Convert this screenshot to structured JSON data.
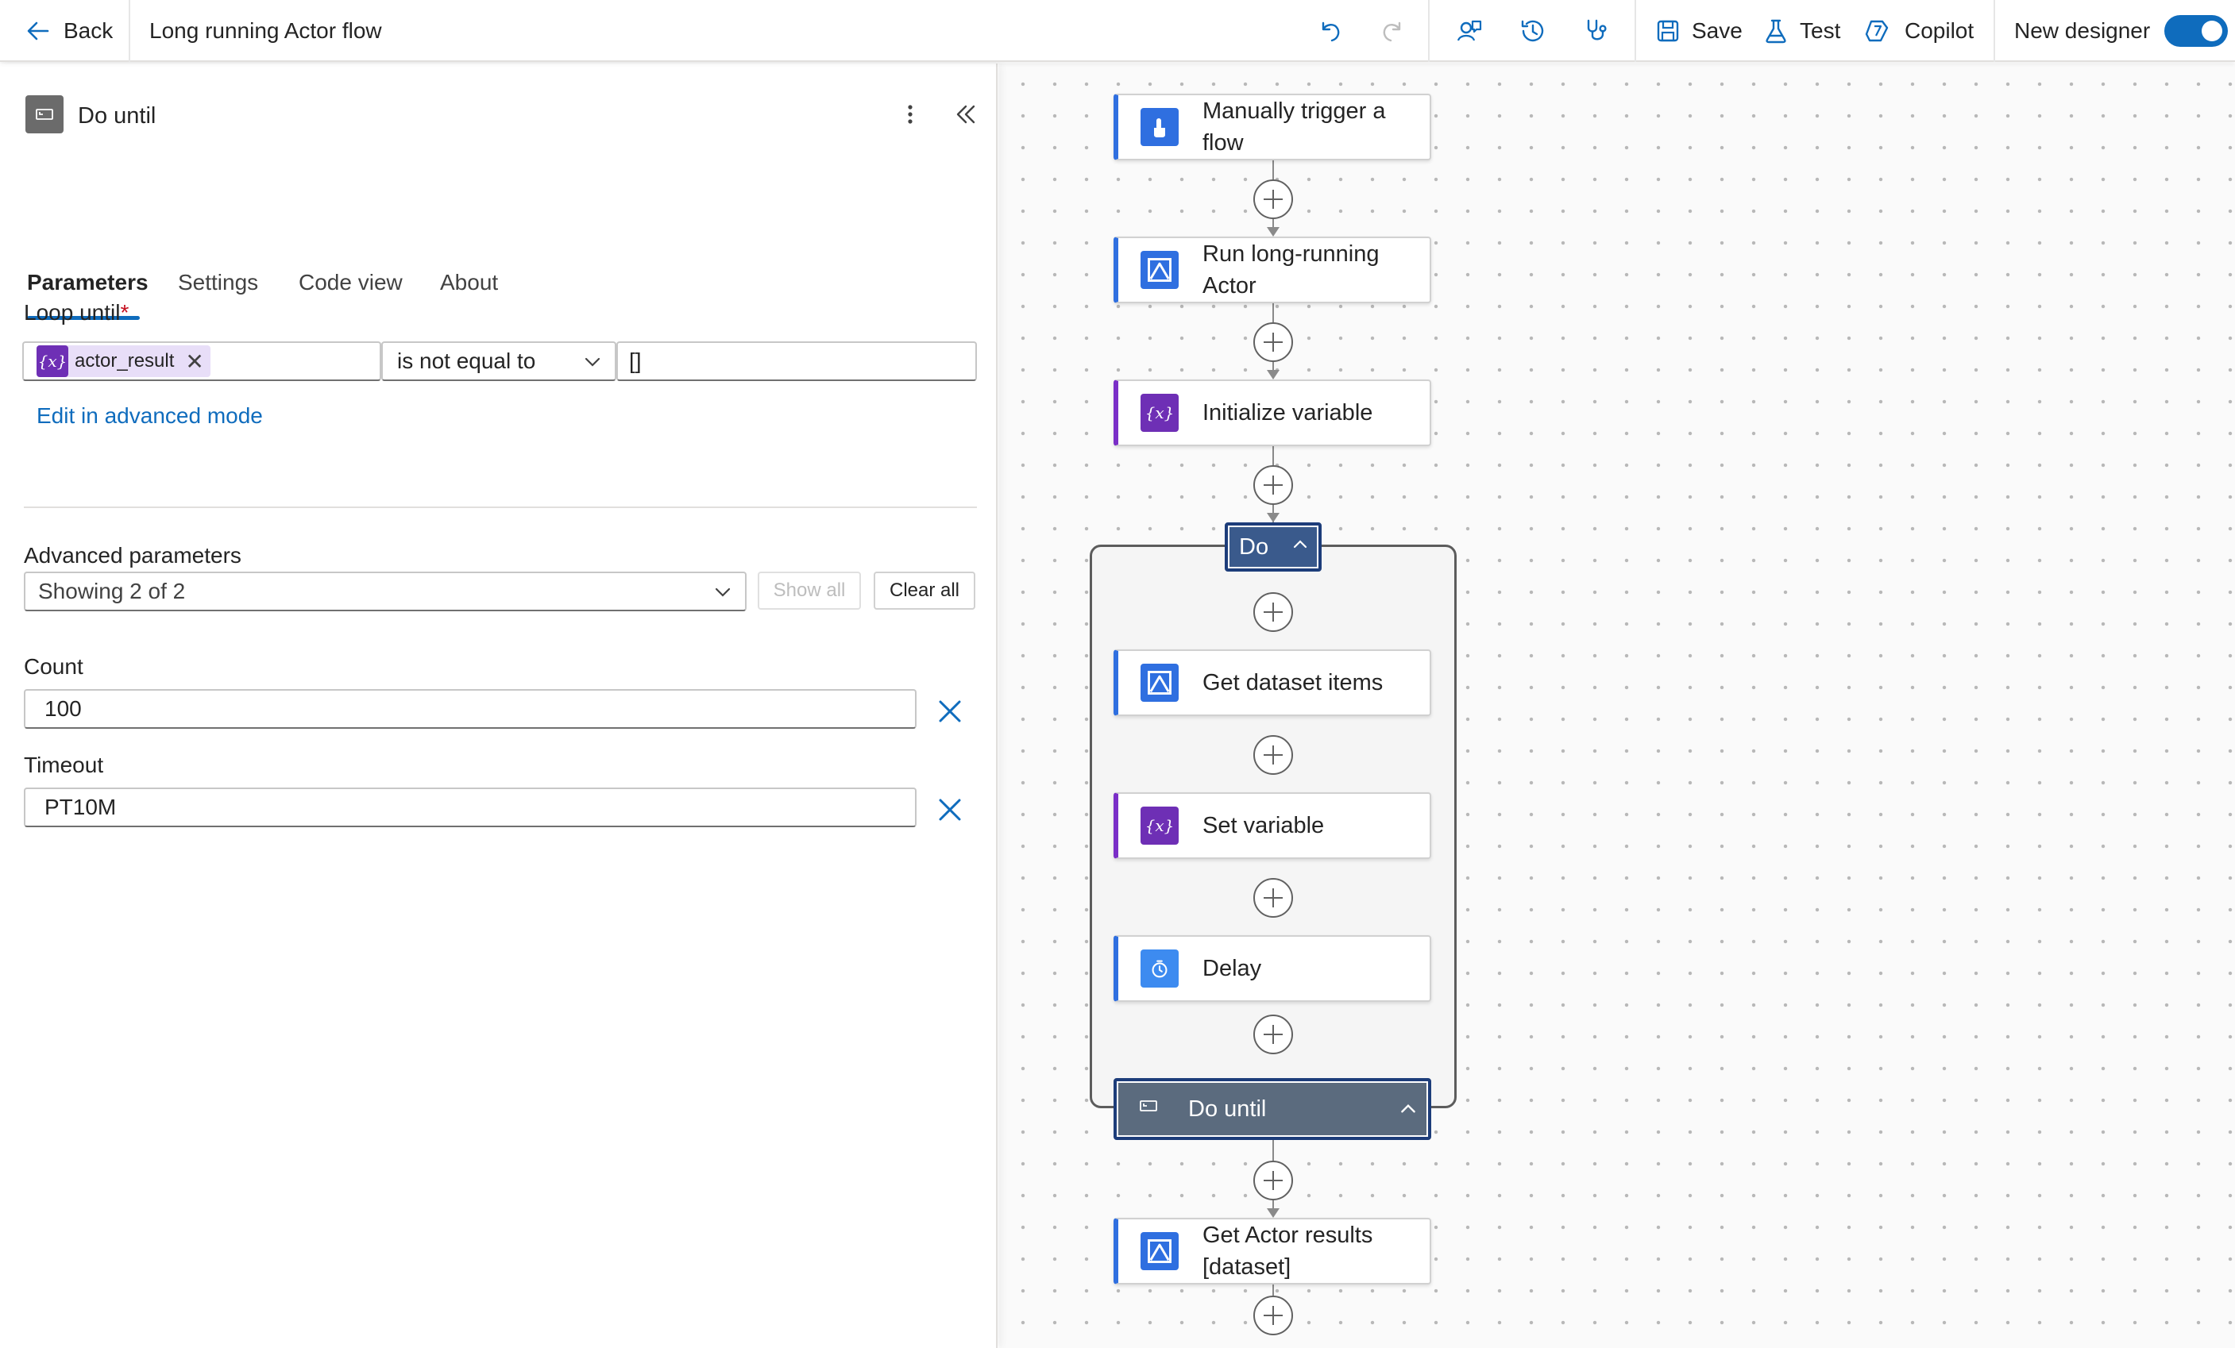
{
  "topbar": {
    "back_label": "Back",
    "flow_title": "Long running Actor flow",
    "save_label": "Save",
    "test_label": "Test",
    "copilot_label": "Copilot",
    "new_designer_label": "New designer",
    "new_designer_on": true
  },
  "panel": {
    "title": "Do until",
    "tabs": [
      {
        "label": "Parameters",
        "active": true
      },
      {
        "label": "Settings",
        "active": false
      },
      {
        "label": "Code view",
        "active": false
      },
      {
        "label": "About",
        "active": false
      }
    ],
    "loop_until": {
      "label": "Loop until",
      "required_mark": "*",
      "left_token": "actor_result",
      "token_icon": "{x}",
      "operator": "is not equal to",
      "right_value": "[]"
    },
    "advanced_mode_link": "Edit in advanced mode",
    "advanced_parameters": {
      "label": "Advanced parameters",
      "selected": "Showing 2 of 2",
      "show_all_label": "Show all",
      "clear_all_label": "Clear all"
    },
    "count": {
      "label": "Count",
      "value": "100"
    },
    "timeout": {
      "label": "Timeout",
      "value": "PT10M"
    }
  },
  "canvas": {
    "nodes": [
      {
        "label_line1": "Manually trigger a",
        "label_line2": "flow",
        "icon": "touch-trigger-icon"
      },
      {
        "label_line1": "Run long-running",
        "label_line2": "Actor",
        "icon": "apify-icon"
      },
      {
        "label": "Initialize variable",
        "icon": "{x}"
      },
      {
        "label": "Get dataset items",
        "icon": "apify-icon"
      },
      {
        "label": "Set variable",
        "icon": "{x}"
      },
      {
        "label": "Delay",
        "icon": "timer-icon"
      },
      {
        "label_line1": "Get Actor results",
        "label_line2": "[dataset]",
        "icon": "apify-icon"
      }
    ],
    "do_label": "Do",
    "do_until_label": "Do until"
  },
  "colors": {
    "accent": "#0f6cbd",
    "connector_blue": "#2f6fe0",
    "variable_purple": "#6e2fb5",
    "scope_header": "#3a5a8c"
  }
}
